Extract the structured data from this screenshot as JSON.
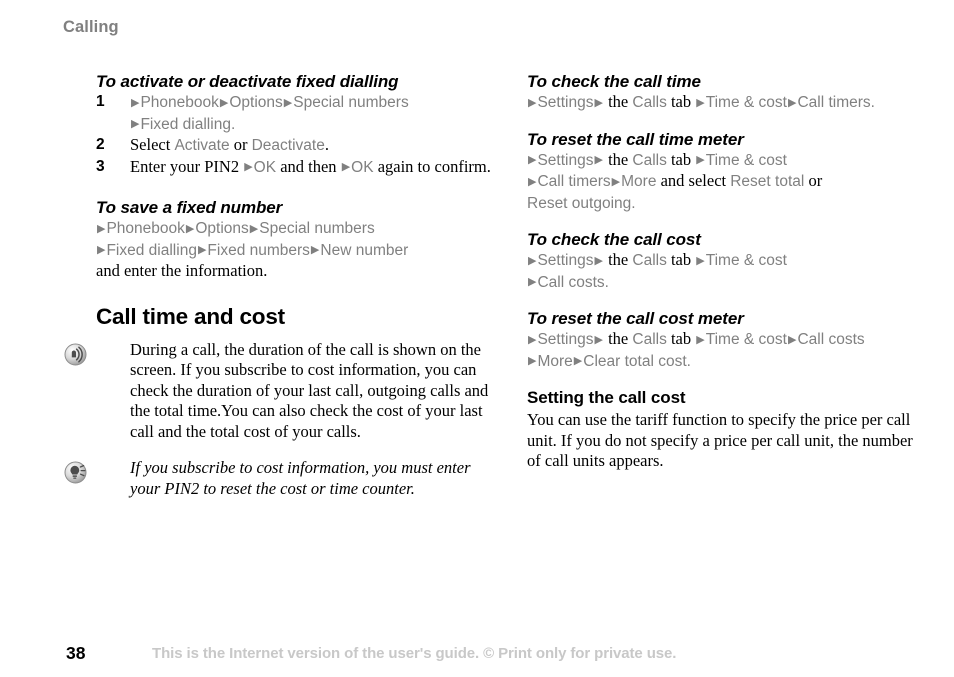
{
  "running_head": "Calling",
  "left_column": {
    "section1": {
      "heading": "To activate or deactivate fixed dialling",
      "steps": [
        {
          "number": "1",
          "parts": [
            {
              "type": "arrow",
              "text": "▶"
            },
            {
              "type": "ui",
              "text": "Phonebook"
            },
            {
              "type": "arrow",
              "text": "▶"
            },
            {
              "type": "ui",
              "text": "Options"
            },
            {
              "type": "arrow",
              "text": "▶"
            },
            {
              "type": "ui",
              "text": "Special numbers"
            },
            {
              "type": "break",
              "text": ""
            },
            {
              "type": "arrow",
              "text": "▶"
            },
            {
              "type": "ui",
              "text": "Fixed dialling"
            },
            {
              "type": "period",
              "text": "."
            }
          ]
        },
        {
          "number": "2",
          "parts": [
            {
              "type": "plain",
              "text": "Select "
            },
            {
              "type": "ui",
              "text": "Activate"
            },
            {
              "type": "plain",
              "text": " or "
            },
            {
              "type": "ui",
              "text": "Deactivate"
            },
            {
              "type": "plain",
              "text": "."
            }
          ]
        },
        {
          "number": "3",
          "parts": [
            {
              "type": "plain",
              "text": "Enter your PIN2 "
            },
            {
              "type": "arrow",
              "text": "▶"
            },
            {
              "type": "ui",
              "text": "OK"
            },
            {
              "type": "plain",
              "text": " and then "
            },
            {
              "type": "arrow",
              "text": "▶"
            },
            {
              "type": "ui",
              "text": "OK"
            },
            {
              "type": "plain",
              "text": " again to confirm."
            }
          ]
        }
      ]
    },
    "section2": {
      "heading": "To save a fixed number",
      "parts": [
        {
          "type": "arrow",
          "text": "▶"
        },
        {
          "type": "ui",
          "text": "Phonebook"
        },
        {
          "type": "arrow",
          "text": "▶"
        },
        {
          "type": "ui",
          "text": "Options"
        },
        {
          "type": "arrow",
          "text": "▶"
        },
        {
          "type": "ui",
          "text": "Special numbers"
        },
        {
          "type": "break",
          "text": ""
        },
        {
          "type": "arrow",
          "text": "▶"
        },
        {
          "type": "ui",
          "text": "Fixed dialling"
        },
        {
          "type": "arrow",
          "text": "▶"
        },
        {
          "type": "ui",
          "text": "Fixed numbers"
        },
        {
          "type": "arrow",
          "text": "▶"
        },
        {
          "type": "ui",
          "text": "New number"
        },
        {
          "type": "break",
          "text": ""
        },
        {
          "type": "plain",
          "text": "and enter the information."
        }
      ]
    },
    "section3": {
      "heading": "Call time and cost",
      "note_icon": "signal-waves-icon",
      "note_text": "During a call, the duration of the call is shown on the screen. If you subscribe to cost information, you can check the duration of your last call, outgoing calls and the total time.You can also check the cost of your last call and the total cost of your calls.",
      "tip_icon": "tip-bulb-icon",
      "tip_text": "If you subscribe to cost information, you must enter your PIN2 to reset the cost or time counter."
    }
  },
  "right_column": {
    "section1": {
      "heading": "To check the call time",
      "parts": [
        {
          "type": "arrow",
          "text": "▶"
        },
        {
          "type": "ui",
          "text": "Settings"
        },
        {
          "type": "arrow",
          "text": "▶"
        },
        {
          "type": "plain",
          "text": " the "
        },
        {
          "type": "ui",
          "text": "Calls"
        },
        {
          "type": "plain",
          "text": " tab "
        },
        {
          "type": "arrow",
          "text": "▶"
        },
        {
          "type": "ui",
          "text": "Time & cost"
        },
        {
          "type": "arrow",
          "text": "▶"
        },
        {
          "type": "ui",
          "text": "Call timers"
        },
        {
          "type": "period",
          "text": "."
        }
      ]
    },
    "section2": {
      "heading": "To reset the call time meter",
      "parts": [
        {
          "type": "arrow",
          "text": "▶"
        },
        {
          "type": "ui",
          "text": "Settings"
        },
        {
          "type": "arrow",
          "text": "▶"
        },
        {
          "type": "plain",
          "text": " the "
        },
        {
          "type": "ui",
          "text": "Calls"
        },
        {
          "type": "plain",
          "text": " tab "
        },
        {
          "type": "arrow",
          "text": "▶"
        },
        {
          "type": "ui",
          "text": "Time & cost"
        },
        {
          "type": "break",
          "text": ""
        },
        {
          "type": "arrow",
          "text": "▶"
        },
        {
          "type": "ui",
          "text": "Call timers"
        },
        {
          "type": "arrow",
          "text": "▶"
        },
        {
          "type": "ui",
          "text": "More"
        },
        {
          "type": "plain",
          "text": " and select "
        },
        {
          "type": "ui",
          "text": "Reset total"
        },
        {
          "type": "plain",
          "text": " or "
        },
        {
          "type": "break",
          "text": ""
        },
        {
          "type": "ui",
          "text": "Reset outgoing"
        },
        {
          "type": "period",
          "text": "."
        }
      ]
    },
    "section3": {
      "heading": "To check the call cost",
      "parts": [
        {
          "type": "arrow",
          "text": "▶"
        },
        {
          "type": "ui",
          "text": "Settings"
        },
        {
          "type": "arrow",
          "text": "▶"
        },
        {
          "type": "plain",
          "text": " the "
        },
        {
          "type": "ui",
          "text": "Calls"
        },
        {
          "type": "plain",
          "text": " tab "
        },
        {
          "type": "arrow",
          "text": "▶"
        },
        {
          "type": "ui",
          "text": "Time & cost"
        },
        {
          "type": "break",
          "text": ""
        },
        {
          "type": "arrow",
          "text": "▶"
        },
        {
          "type": "ui",
          "text": "Call costs"
        },
        {
          "type": "period",
          "text": "."
        }
      ]
    },
    "section4": {
      "heading": "To reset the call cost meter",
      "parts": [
        {
          "type": "arrow",
          "text": "▶"
        },
        {
          "type": "ui",
          "text": "Settings"
        },
        {
          "type": "arrow",
          "text": "▶"
        },
        {
          "type": "plain",
          "text": " the "
        },
        {
          "type": "ui",
          "text": "Calls"
        },
        {
          "type": "plain",
          "text": " tab "
        },
        {
          "type": "arrow",
          "text": "▶"
        },
        {
          "type": "ui",
          "text": "Time & cost"
        },
        {
          "type": "arrow",
          "text": "▶"
        },
        {
          "type": "ui",
          "text": "Call costs"
        },
        {
          "type": "break",
          "text": ""
        },
        {
          "type": "arrow",
          "text": "▶"
        },
        {
          "type": "ui",
          "text": "More"
        },
        {
          "type": "arrow",
          "text": "▶"
        },
        {
          "type": "ui",
          "text": "Clear total cost"
        },
        {
          "type": "period",
          "text": "."
        }
      ]
    },
    "section5": {
      "heading": "Setting the call cost",
      "text": "You can use the tariff function to specify the price per call unit. If you do not specify a price per call unit, the number of call units appears."
    }
  },
  "footer": {
    "page_number": "38",
    "text": "This is the Internet version of the user's guide. © Print only for private use."
  },
  "colors": {
    "ui_gray": "#808080",
    "body_black": "#000000",
    "footer_gray": "#c8c8c8"
  }
}
